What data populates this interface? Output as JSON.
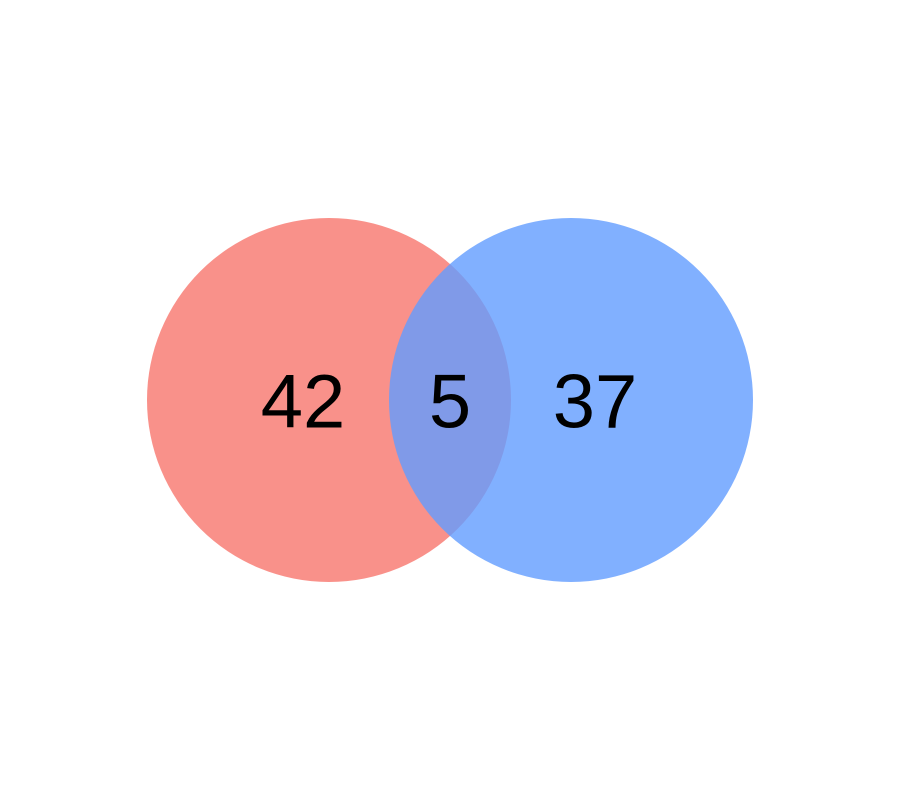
{
  "venn": {
    "sets": [
      {
        "id": "left",
        "color": "#f8766d",
        "opacity": 0.8
      },
      {
        "id": "right",
        "color": "#619cff",
        "opacity": 0.8
      }
    ],
    "counts": {
      "left_only": "42",
      "intersection": "5",
      "right_only": "37"
    }
  }
}
